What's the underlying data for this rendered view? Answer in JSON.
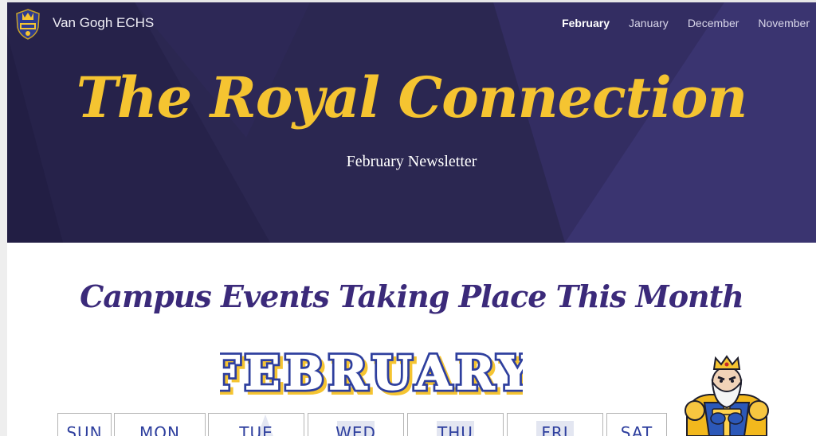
{
  "header": {
    "site_name": "Van Gogh ECHS",
    "logo_icon": "royals-shield-icon",
    "nav": [
      {
        "label": "February",
        "active": true
      },
      {
        "label": "January",
        "active": false
      },
      {
        "label": "December",
        "active": false
      },
      {
        "label": "November",
        "active": false
      }
    ]
  },
  "hero": {
    "title": "The Royal Connection",
    "subtitle": "February Newsletter"
  },
  "events": {
    "heading": "Campus Events Taking Place This Month",
    "month_label": "FEBRUARY",
    "weekdays": [
      "SUN",
      "MON",
      "TUE",
      "WED",
      "THU",
      "FRI",
      "SAT"
    ],
    "mascot_icon": "king-mascot-icon"
  },
  "colors": {
    "hero_bg": "#2c2852",
    "gold": "#f5c431",
    "purple_heading": "#3b2a7a",
    "calendar_blue": "#2e3f9e"
  }
}
